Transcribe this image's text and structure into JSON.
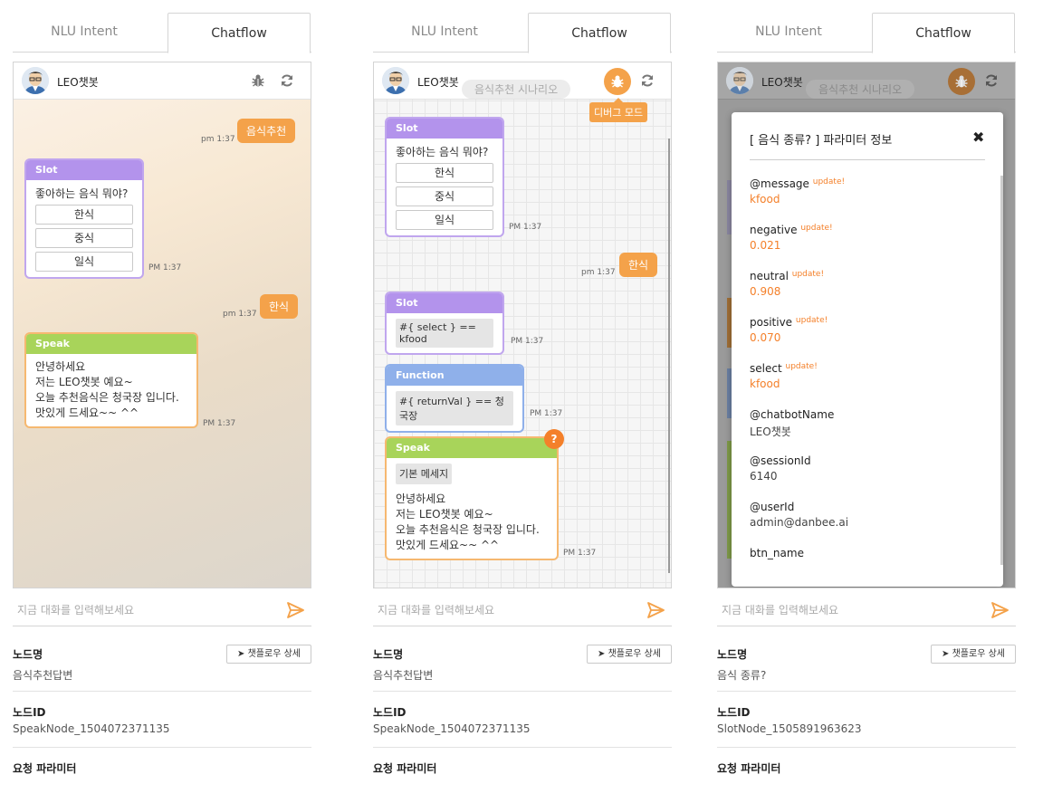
{
  "tabs": {
    "nlu": "NLU Intent",
    "chatflow": "Chatflow"
  },
  "bot_name": "LEO챗봇",
  "scenario_label": "음식추천 시나리오",
  "debug_mode_label": "디버그 모드",
  "input_placeholder": "지금 대화를 입력해보세요",
  "details_button": "챗플로우 상세",
  "labels": {
    "node_name": "노드명",
    "node_id": "노드ID",
    "request_params": "요청 파라미터"
  },
  "panel1": {
    "user_msg1": "음식추천",
    "user_msg1_time": "pm 1:37",
    "slot_title": "Slot",
    "slot_question": "좋아하는 음식 뭐야?",
    "options": [
      "한식",
      "중식",
      "일식"
    ],
    "slot_time": "PM 1:37",
    "user_msg2": "한식",
    "user_msg2_time": "pm 1:37",
    "speak_title": "Speak",
    "speak_lines": [
      "안녕하세요",
      "저는 LEO챗봇 예요~",
      "오늘 추천음식은 청국장 입니다.",
      "맛있게 드세요~~ ^^"
    ],
    "speak_time": "PM 1:37",
    "node_name": "음식추천답변",
    "node_id": "SpeakNode_1504072371135"
  },
  "panel2": {
    "slot_title": "Slot",
    "slot_question": "좋아하는 음식 뭐야?",
    "options": [
      "한식",
      "중식",
      "일식"
    ],
    "slot_time": "PM 1:37",
    "user_msg": "한식",
    "user_msg_time": "pm 1:37",
    "slot2_title": "Slot",
    "slot2_code": "#{ select } == kfood",
    "slot2_time": "PM 1:37",
    "func_title": "Function",
    "func_code": "#{ returnVal } == 청국장",
    "func_time": "PM 1:37",
    "speak_title": "Speak",
    "speak_badge": "?",
    "speak_tag": "기본 메세지",
    "speak_lines": [
      "안녕하세요",
      "저는 LEO챗봇 예요~",
      "오늘 추천음식은 청국장 입니다.",
      "맛있게 드세요~~ ^^"
    ],
    "speak_time": "PM 1:37",
    "node_name": "음식추천답변",
    "node_id": "SpeakNode_1504072371135"
  },
  "panel3": {
    "modal_title": "[ 음식 종류? ] 파라미터 정보",
    "update_label": "update!",
    "params": [
      {
        "key": "@message",
        "value": "kfood",
        "updated": true
      },
      {
        "key": "negative",
        "value": "0.021",
        "updated": true
      },
      {
        "key": "neutral",
        "value": "0.908",
        "updated": true
      },
      {
        "key": "positive",
        "value": "0.070",
        "updated": true
      },
      {
        "key": "select",
        "value": "kfood",
        "updated": true
      },
      {
        "key": "@chatbotName",
        "value": "LEO챗봇",
        "updated": false
      },
      {
        "key": "@sessionId",
        "value": "6140",
        "updated": false
      },
      {
        "key": "@userId",
        "value": "admin@danbee.ai",
        "updated": false
      },
      {
        "key": "btn_name",
        "value": "",
        "updated": false
      }
    ],
    "node_name": "음식 종류?",
    "node_id": "SlotNode_1505891963623"
  },
  "colors": {
    "accent": "#f4a24a",
    "slot": "#b393ec",
    "speak": "#a8d45a",
    "function": "#8fb0ea",
    "update": "#f4802a"
  },
  "icons": [
    "bug-icon",
    "refresh-icon",
    "send-icon",
    "location-arrow-icon",
    "close-icon",
    "avatar"
  ]
}
